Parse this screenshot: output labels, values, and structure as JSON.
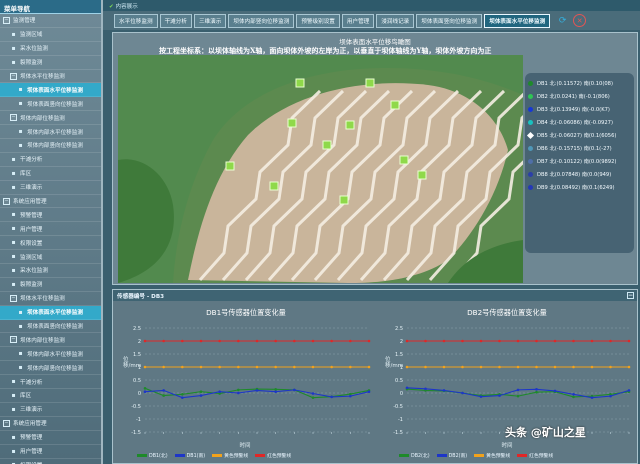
{
  "sidebar": {
    "header": "菜单导航",
    "items": [
      {
        "label": "监测管理",
        "lvl": 0,
        "icon": "minus-box"
      },
      {
        "label": "监测区域",
        "lvl": 1,
        "icon": "page"
      },
      {
        "label": "采水位监测",
        "lvl": 1,
        "icon": "page"
      },
      {
        "label": "裂隙监测",
        "lvl": 1,
        "icon": "page"
      },
      {
        "label": "坝体水平位移监测",
        "lvl": 1,
        "icon": "minus-box"
      },
      {
        "label": "坝体表面水平位移监测",
        "lvl": 2,
        "icon": "page",
        "active": true
      },
      {
        "label": "坝体表面竖向位移监测",
        "lvl": 2,
        "icon": "page"
      },
      {
        "label": "坝体内部位移监测",
        "lvl": 1,
        "icon": "minus-box"
      },
      {
        "label": "坝体内部水平位移监测",
        "lvl": 2,
        "icon": "page"
      },
      {
        "label": "坝体内部竖向位移监测",
        "lvl": 2,
        "icon": "page"
      },
      {
        "label": "干滩分析",
        "lvl": 1,
        "icon": "page"
      },
      {
        "label": "库区",
        "lvl": 1,
        "icon": "page"
      },
      {
        "label": "三维演示",
        "lvl": 1,
        "icon": "page"
      },
      {
        "label": "系统应用管理",
        "lvl": 0,
        "icon": "minus-box"
      },
      {
        "label": "预警管理",
        "lvl": 1,
        "icon": "page"
      },
      {
        "label": "用户管理",
        "lvl": 1,
        "icon": "page"
      },
      {
        "label": "权限设置",
        "lvl": 1,
        "icon": "page"
      },
      {
        "label": "监测区域",
        "lvl": 1,
        "icon": "page"
      },
      {
        "label": "采水位监测",
        "lvl": 1,
        "icon": "page"
      },
      {
        "label": "裂隙监测",
        "lvl": 1,
        "icon": "page"
      },
      {
        "label": "坝体水平位移监测",
        "lvl": 1,
        "icon": "minus-box"
      },
      {
        "label": "坝体表面水平位移监测",
        "lvl": 2,
        "icon": "page",
        "active": true
      },
      {
        "label": "坝体表面竖向位移监测",
        "lvl": 2,
        "icon": "page"
      },
      {
        "label": "坝体内部位移监测",
        "lvl": 1,
        "icon": "minus-box"
      },
      {
        "label": "坝体内部水平位移监测",
        "lvl": 2,
        "icon": "page"
      },
      {
        "label": "坝体内部竖向位移监测",
        "lvl": 2,
        "icon": "page"
      },
      {
        "label": "干滩分析",
        "lvl": 1,
        "icon": "page"
      },
      {
        "label": "库区",
        "lvl": 1,
        "icon": "page"
      },
      {
        "label": "三维演示",
        "lvl": 1,
        "icon": "page"
      },
      {
        "label": "系统应用管理",
        "lvl": 0,
        "icon": "minus-box"
      },
      {
        "label": "预警管理",
        "lvl": 1,
        "icon": "page"
      },
      {
        "label": "用户管理",
        "lvl": 1,
        "icon": "page"
      },
      {
        "label": "权限设置",
        "lvl": 1,
        "icon": "page"
      }
    ]
  },
  "breadcrumb": "内容展示",
  "toolbar": {
    "tabs": [
      {
        "label": "水平位移监测"
      },
      {
        "label": "干滩分析"
      },
      {
        "label": "三维演示"
      },
      {
        "label": "坝体内部竖向位移监测"
      },
      {
        "label": "预警级别设置"
      },
      {
        "label": "用户管理"
      },
      {
        "label": "浸润线记录"
      },
      {
        "label": "坝体表面竖向位移监测"
      },
      {
        "label": "坝体表面水平位移监测",
        "active": true
      }
    ],
    "refresh_icon": "refresh-icon",
    "close_icon": "close-icon"
  },
  "map": {
    "title": "坝体表面水平位移鸟瞰图",
    "note": "按工程坐标系：以坝体轴线为X轴，面向坝体外坡的左岸为正，以垂直于坝体轴线为Y轴，坝体外坡方向为正",
    "colors": {
      "terrain": "#4e8a47",
      "tailings": "#c9b59b",
      "ridge": "#f4ede2",
      "marker": "#8fd94a"
    },
    "legend": [
      {
        "label": "DB1 北:(0.11572) 南(0.10(08)",
        "color": "#1e8a2a",
        "shape": "dot"
      },
      {
        "label": "DB2 北(0.0241) 南(-0.1(806)",
        "color": "#2fc455",
        "shape": "dot"
      },
      {
        "label": "DB3 北(0.13949) 南(-0.0(K7)",
        "color": "#1636d8",
        "shape": "dot"
      },
      {
        "label": "DB4 北(-0.06086) 南(-0.0927)",
        "color": "#19c2c0",
        "shape": "dot"
      },
      {
        "label": "DB5 北(-0.06027) 南(0.1(6056)",
        "color": "#ffffff",
        "shape": "diamond"
      },
      {
        "label": "DB6 北(-0.15715) 南(0.1(-27)",
        "color": "#4f97b8",
        "shape": "dot"
      },
      {
        "label": "DB7 北(-0.10122) 南(0.0(9892)",
        "color": "#4f6fa8",
        "shape": "dot"
      },
      {
        "label": "DB8 北(0.07848) 南(0.0(949)",
        "color": "#2b3fa8",
        "shape": "dot"
      },
      {
        "label": "DB9 北(0.08492) 南(0.1(6249)",
        "color": "#2438b8",
        "shape": "dot"
      }
    ]
  },
  "chart_panel": {
    "header": "传感器编号 - DB3",
    "minimize_label": "−"
  },
  "chart_data": [
    {
      "type": "line",
      "title": "DB1号传感器位置变化量",
      "xlabel": "时间",
      "ylabel": "位移/mm",
      "ylim": [
        -1.5,
        2.5
      ],
      "yticks": [
        2.5,
        2,
        1.5,
        1,
        0.5,
        0,
        -0.5,
        -1,
        -1.5
      ],
      "x": [
        "t1",
        "t2",
        "t3",
        "t4",
        "t5",
        "t6",
        "t7",
        "t8",
        "t9",
        "t10",
        "t11",
        "t12",
        "t13"
      ],
      "series": [
        {
          "name": "DB1(北)",
          "color": "#1e8a2a",
          "values": [
            0.18,
            -0.1,
            -0.05,
            0.05,
            -0.02,
            0.12,
            0.15,
            0.14,
            0.12,
            -0.18,
            -0.14,
            -0.04,
            0.1
          ]
        },
        {
          "name": "DB1(南)",
          "color": "#1d36c8",
          "values": [
            0.05,
            0.1,
            -0.18,
            -0.1,
            0.05,
            0.0,
            0.1,
            0.05,
            0.12,
            -0.02,
            -0.15,
            -0.12,
            0.05
          ]
        },
        {
          "name": "黄色预警线",
          "color": "#f2a21b",
          "values": [
            1,
            1,
            1,
            1,
            1,
            1,
            1,
            1,
            1,
            1,
            1,
            1,
            1
          ]
        },
        {
          "name": "红色预警线",
          "color": "#e02727",
          "values": [
            2,
            2,
            2,
            2,
            2,
            2,
            2,
            2,
            2,
            2,
            2,
            2,
            2
          ]
        }
      ]
    },
    {
      "type": "line",
      "title": "DB2号传感器位置变化量",
      "xlabel": "时间",
      "ylabel": "位移/mm",
      "ylim": [
        -1.5,
        2.5
      ],
      "yticks": [
        2.5,
        2,
        1.5,
        1,
        0.5,
        0,
        -0.5,
        -1,
        -1.5
      ],
      "x": [
        "t1",
        "t2",
        "t3",
        "t4",
        "t5",
        "t6",
        "t7",
        "t8",
        "t9",
        "t10",
        "t11",
        "t12",
        "t13"
      ],
      "series": [
        {
          "name": "DB2(北)",
          "color": "#1e8a2a",
          "values": [
            0.15,
            0.1,
            0.08,
            0.0,
            -0.1,
            -0.05,
            -0.12,
            0.03,
            0.05,
            -0.15,
            -0.12,
            -0.05,
            0.05
          ]
        },
        {
          "name": "DB2(南)",
          "color": "#1d36c8",
          "values": [
            0.2,
            0.16,
            0.1,
            0.0,
            -0.14,
            -0.1,
            0.12,
            0.14,
            0.08,
            -0.05,
            -0.18,
            -0.12,
            0.1
          ]
        },
        {
          "name": "黄色预警线",
          "color": "#f2a21b",
          "values": [
            1,
            1,
            1,
            1,
            1,
            1,
            1,
            1,
            1,
            1,
            1,
            1,
            1
          ]
        },
        {
          "name": "红色预警线",
          "color": "#e02727",
          "values": [
            2,
            2,
            2,
            2,
            2,
            2,
            2,
            2,
            2,
            2,
            2,
            2,
            2
          ]
        }
      ]
    }
  ],
  "overlay_caption": "头条 @矿山之星"
}
